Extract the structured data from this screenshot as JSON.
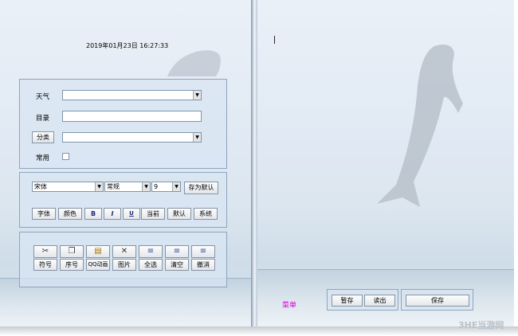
{
  "datetime": "2019年01月23日  16:27:33",
  "form": {
    "weather_label": "天气",
    "catalog_label": "目录",
    "category_button": "分类",
    "common_label": "常用"
  },
  "format_bar": {
    "font_name": "宋体",
    "font_style": "常规",
    "font_size": "9",
    "save_default_button": "存为默认",
    "buttons": {
      "font": "字体",
      "color": "颜色",
      "bold": "B",
      "italic": "I",
      "underline": "U",
      "current": "当前",
      "default": "默认",
      "system": "系统"
    }
  },
  "tools": {
    "icons": [
      "scissors-icon",
      "copy-icon",
      "paste-icon",
      "close-x-icon",
      "align-left-icon",
      "align-center-icon",
      "align-right-icon"
    ],
    "labels": {
      "symbol": "符号",
      "number": "序号",
      "qq_anim": "QQ动画",
      "picture": "图片",
      "select_all": "全选",
      "clear": "清空",
      "undo": "撤消"
    }
  },
  "right_page": {
    "menu_label": "菜单",
    "draft_button": "暂存",
    "read_button": "读出",
    "save_button": "保存"
  },
  "watermark": "3HE当游网",
  "colors": {
    "menu_label": "#e000e0",
    "panel_border": "#8ea4bc"
  }
}
